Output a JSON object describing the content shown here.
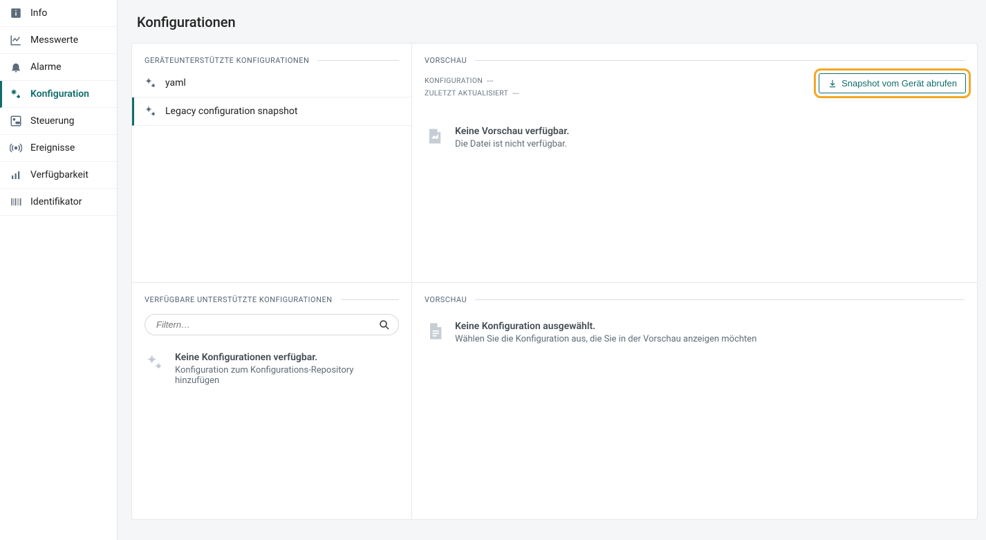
{
  "sidebar": {
    "items": [
      {
        "label": "Info"
      },
      {
        "label": "Messwerte"
      },
      {
        "label": "Alarme"
      },
      {
        "label": "Konfiguration"
      },
      {
        "label": "Steuerung"
      },
      {
        "label": "Ereignisse"
      },
      {
        "label": "Verfügbarkeit"
      },
      {
        "label": "Identifikator"
      }
    ]
  },
  "page": {
    "title": "Konfigurationen"
  },
  "left": {
    "supported_header": "GERÄTEUNTERSTÜTZTE KONFIGURATIONEN",
    "items": [
      {
        "label": "yaml"
      },
      {
        "label": "Legacy configuration snapshot"
      }
    ],
    "available_header": "VERFÜGBARE UNTERSTÜTZTE KONFIGURATIONEN",
    "filter_placeholder": "Filtern…",
    "empty_title": "Keine Konfigurationen verfügbar.",
    "empty_text": "Konfiguration zum Konfigurations-Repository hinzufügen"
  },
  "right": {
    "preview_header_top": "VORSCHAU",
    "meta_config_label": "KONFIGURATION",
    "meta_config_value": "---",
    "meta_updated_label": "ZULETZT AKTUALISIERT",
    "meta_updated_value": "---",
    "snapshot_button": "Snapshot vom Gerät abrufen",
    "top_empty_title": "Keine Vorschau verfügbar.",
    "top_empty_text": "Die Datei ist nicht verfügbar.",
    "preview_header_bottom": "VORSCHAU",
    "bottom_empty_title": "Keine Konfiguration ausgewählt.",
    "bottom_empty_text": "Wählen Sie die Konfiguration aus, die Sie in der Vorschau anzeigen möchten"
  }
}
